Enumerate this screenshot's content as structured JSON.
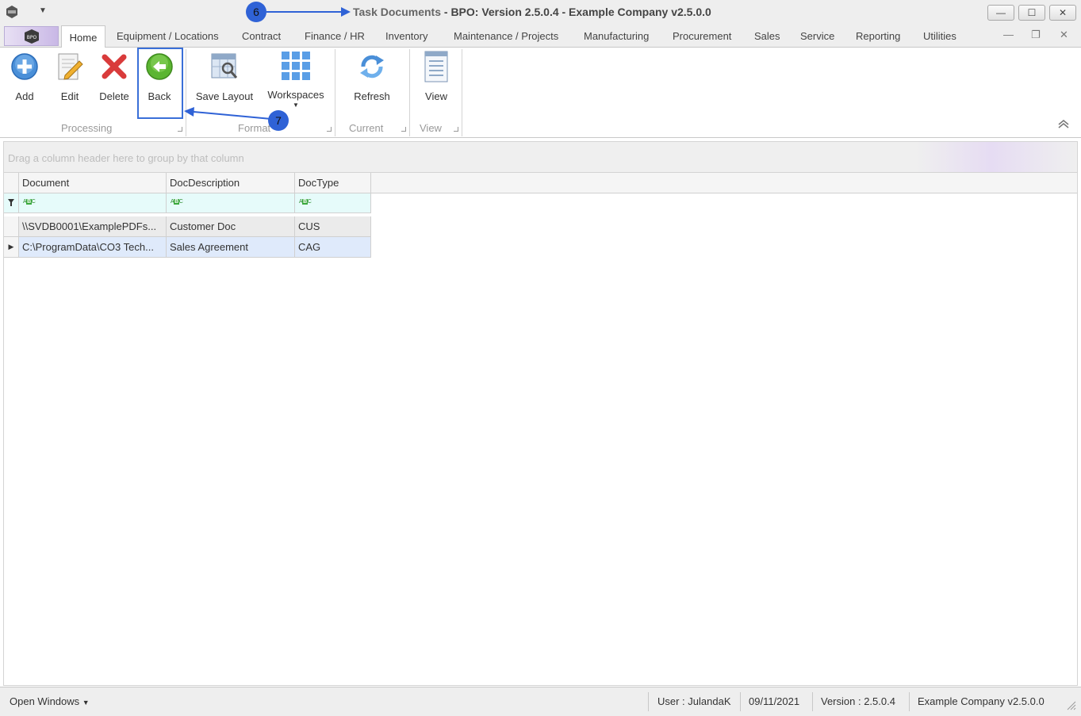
{
  "titlebar": {
    "title_prefix": "Task Documents",
    "title_main": " - BPO: Version 2.5.0.4 - Example Company v2.5.0.0",
    "minimize": "—",
    "maximize": "☐",
    "close": "✕"
  },
  "tabs": [
    {
      "label": "Home"
    },
    {
      "label": "Equipment / Locations"
    },
    {
      "label": "Contract"
    },
    {
      "label": "Finance / HR"
    },
    {
      "label": "Inventory"
    },
    {
      "label": "Maintenance / Projects"
    },
    {
      "label": "Manufacturing"
    },
    {
      "label": "Procurement"
    },
    {
      "label": "Sales"
    },
    {
      "label": "Service"
    },
    {
      "label": "Reporting"
    },
    {
      "label": "Utilities"
    }
  ],
  "ribbon": {
    "buttons": {
      "add": "Add",
      "edit": "Edit",
      "delete": "Delete",
      "back": "Back",
      "save_layout": "Save Layout",
      "workspaces": "Workspaces",
      "refresh": "Refresh",
      "view": "View"
    },
    "groups": {
      "processing": "Processing",
      "format": "Format",
      "current": "Current",
      "view": "View"
    }
  },
  "annotations": {
    "marker6": "6",
    "marker7": "7"
  },
  "grid": {
    "group_panel_text": "Drag a column header here to group by that column",
    "columns": [
      "Document",
      "DocDescription",
      "DocType"
    ],
    "filter_icon_text": "ABC",
    "rows": [
      {
        "document": "\\\\SVDB0001\\ExamplePDFs...",
        "description": "Customer Doc",
        "type": "CUS"
      },
      {
        "document": "C:\\ProgramData\\CO3 Tech...",
        "description": "Sales Agreement",
        "type": "CAG"
      }
    ]
  },
  "statusbar": {
    "open_windows": "Open Windows",
    "user": "User : JulandaK",
    "date": "09/11/2021",
    "version": "Version : 2.5.0.4",
    "company": "Example Company v2.5.0.0"
  },
  "colors": {
    "accent_blue": "#2f62d6",
    "delete_red": "#d93b3b",
    "back_green": "#5bb531"
  }
}
